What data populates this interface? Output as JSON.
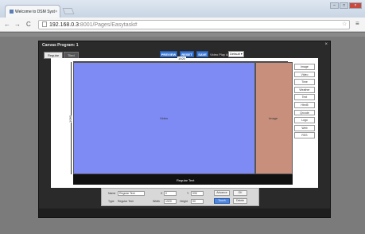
{
  "browser": {
    "tab_title": "Welcome to DSM Syst",
    "tab_close": "×",
    "address_host": "192.168.0.3",
    "address_path": ":8001/Pages/Easytask#",
    "back": "←",
    "forward": "→",
    "reload": "C",
    "star": "☆",
    "menu": "≡",
    "win_minimize": "–",
    "win_maximize": "□",
    "win_close": "×"
  },
  "modal": {
    "title": "Canvas Program: 1",
    "close": "×",
    "tabs": [
      {
        "label": "Regular"
      },
      {
        "label": "Tiled"
      }
    ],
    "buttons": {
      "preview": "PREVIEW",
      "reset": "RESET",
      "save": "SAVE"
    },
    "fit_label": "Video Play Area",
    "fit_value": "Default ▾"
  },
  "canvas": {
    "width_label": "1920",
    "height_label": "1080",
    "zones": {
      "blue_label": "Video",
      "brown_label": "Image",
      "ticker_label": "Regular Text"
    },
    "colors": {
      "blue": "#7f8bf5",
      "brown": "#c88f7d",
      "ticker": "#111111"
    }
  },
  "side_menu": {
    "items": [
      "Image",
      "Video",
      "Time",
      "Weather",
      "Text",
      "Html5",
      "Qrcode",
      "Logo",
      "Web",
      "RSS"
    ]
  },
  "props": {
    "name_label": "Name",
    "name_value": "Regular Text",
    "x_label": "X",
    "x_value": "0",
    "y_label": "Y",
    "y_value": "990",
    "type_label": "Type",
    "type_value": "Regular Text",
    "width_label": "Width",
    "width_value": "1920",
    "height_label": "Height",
    "height_value": "90",
    "btn_advance": "Advance",
    "btn_ok": "OK",
    "btn_touch": "Touch",
    "btn_delete": "Delete"
  }
}
